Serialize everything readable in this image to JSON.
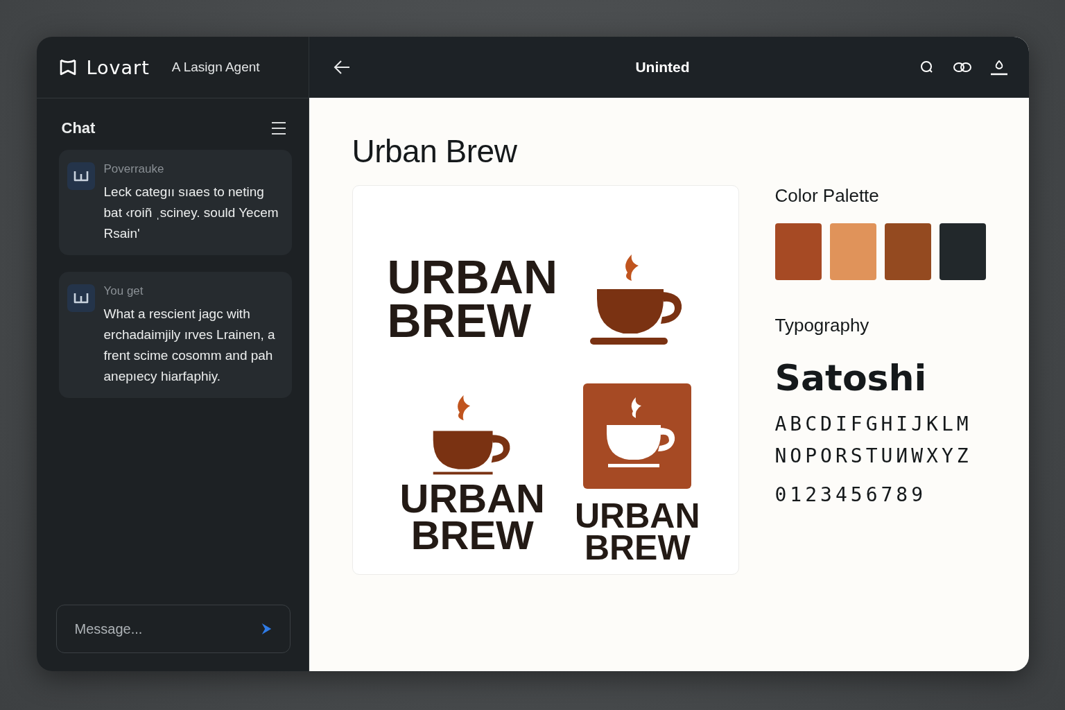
{
  "brand": {
    "name": "Lovart",
    "tagline": "A Lasign Agent"
  },
  "chat": {
    "title": "Chat",
    "messages": [
      {
        "author": "Poverrauke",
        "text": "Leck categıı sıaes to neting bat ‹roiñ ˌsciney. sould Yecem Rsain'"
      },
      {
        "author": "You get",
        "text": "What a rescient jagc with erchadaimjily ırves Lrainen, a frent scime cosomm and pah anepıecy hiarfaphiy."
      }
    ],
    "composer": {
      "placeholder": "Message..."
    }
  },
  "document": {
    "title": "Uninted",
    "heading": "Urban Brew",
    "logos": [
      {
        "kind": "wordmark",
        "lines": [
          "URBAN",
          "BREW"
        ]
      },
      {
        "kind": "cup"
      },
      {
        "kind": "stacked",
        "lines": [
          "URBAN",
          "BREW"
        ]
      },
      {
        "kind": "badge",
        "lines": [
          "URBAN",
          "BREW"
        ]
      }
    ],
    "palette": {
      "title": "Color Palette",
      "swatches": [
        {
          "color": "#a64a24"
        },
        {
          "color": "#e0935a"
        },
        {
          "color": "#944a20"
        },
        {
          "color": "#22282b"
        }
      ]
    },
    "typography": {
      "title": "Typography",
      "font": "Satoshi",
      "lines": [
        "ABCDIFGHIJKLM",
        "NOPORSTUИWXYZ",
        "0123456789"
      ]
    }
  }
}
